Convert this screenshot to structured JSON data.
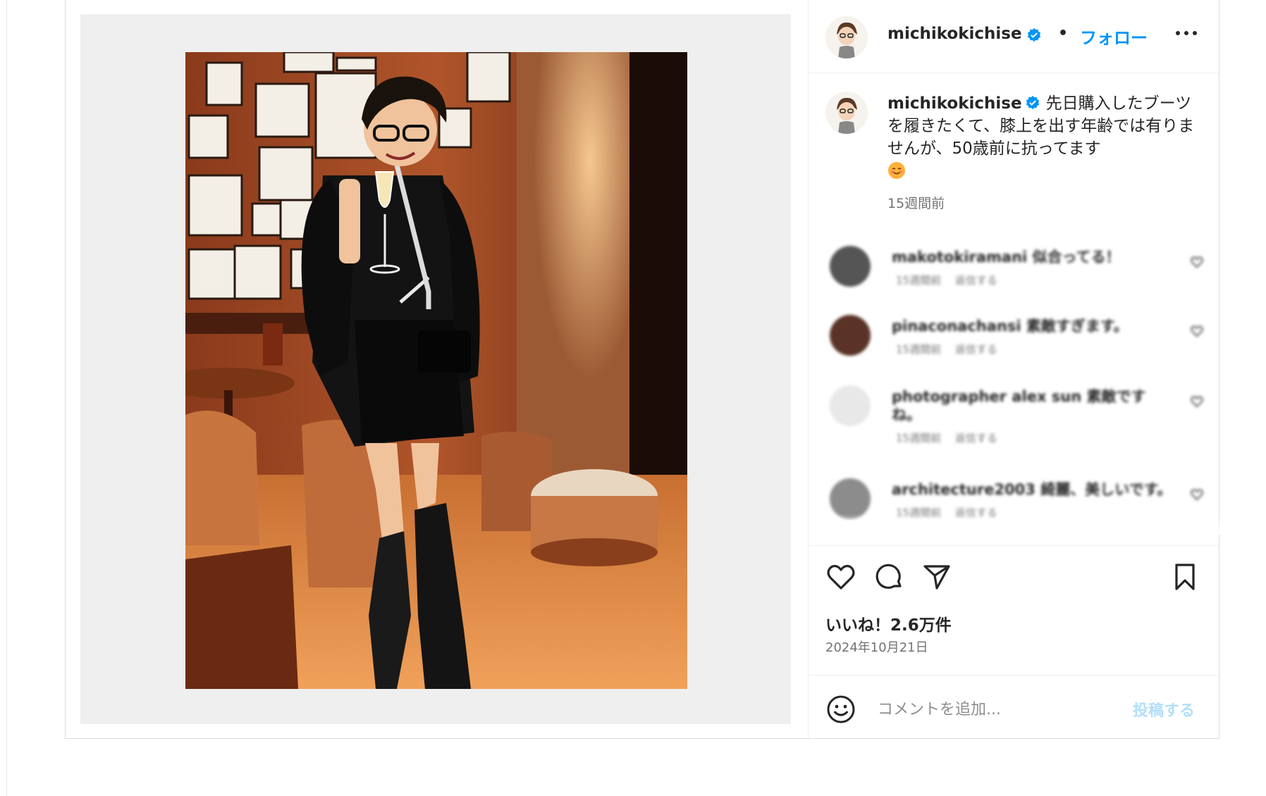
{
  "post": {
    "username": "michikokichise",
    "follow_label": "フォロー",
    "separator": "•",
    "caption": "先日購入したブーツを履きたくて、膝上を出す年齢では有りませんが、50歳前に抗ってます",
    "posted_ago": "15週間前",
    "likes": "いいね！2.6万件",
    "date": "2024年10月21日"
  },
  "comments": [
    {
      "user_text": "makotokiramani 似合ってる！",
      "meta": "15週間前　 返信する"
    },
    {
      "user_text": "pinaconachansi 素敵すぎます。",
      "meta": "15週間前　 返信する"
    },
    {
      "user_text": "photographer alex sun 素敵です",
      "user_text_2": "ね。",
      "meta": "15週間前　 返信する"
    },
    {
      "user_text": "architecture2003 綺麗、美しいです。",
      "meta": "15週間前　 返信する"
    }
  ],
  "comment_box": {
    "placeholder": "コメントを追加...",
    "post_label": "投稿する"
  },
  "colors": {
    "accent": "#0095f6",
    "verified": "#0095f6",
    "text": "#262626",
    "secondary": "#737373",
    "post_disabled": "#b2dffc"
  },
  "icons": {
    "header": [
      "verified-badge-icon",
      "more-options-icon"
    ],
    "actions": [
      "heart-icon",
      "comment-icon",
      "share-icon",
      "bookmark-icon"
    ],
    "comment_box": [
      "emoji-icon"
    ]
  }
}
